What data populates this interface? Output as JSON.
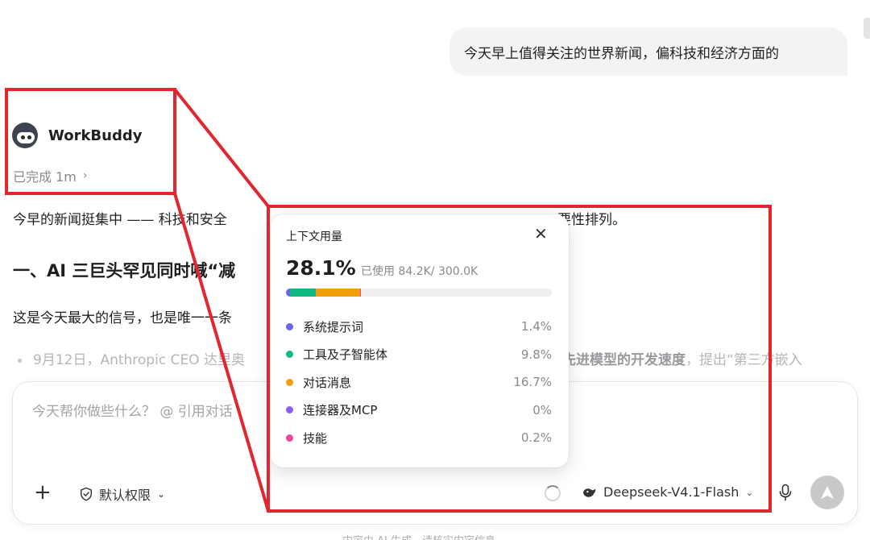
{
  "user_message": "今天早上值得关注的世界新闻，偏科技和经济方面的",
  "assistant": {
    "name": "WorkBuddy",
    "status": "已完成 1m"
  },
  "response": {
    "intro": "今早的新闻挺集中 —— 科技和安全",
    "intro_tail": "要性排列。",
    "heading": "一、AI 三巨头罕见同时喊“减",
    "paragraph": "这是今天最大的信号，也是唯一一条",
    "bullet": "9月12日，Anthropic CEO 达里奥",
    "bullet_tail_bold": "先进模型的开发速度",
    "bullet_tail": "，提出“第三方嵌入"
  },
  "composer": {
    "placeholder": "今天帮你做些什么？ @ 引用对话",
    "add_label": "+",
    "permission_label": "默认权限",
    "model_label": "Deepseek-V4.1-Flash"
  },
  "disclaimer": "内容由 AI 生成，请核实内容信息",
  "context_popover": {
    "title": "上下文用量",
    "percent": "28.1%",
    "used_text": "已使用 84.2K/ 300.0K",
    "items": [
      {
        "label": "系统提示词",
        "value": "1.4%",
        "fraction": 1.4,
        "color": "#6366f1"
      },
      {
        "label": "工具及子智能体",
        "value": "9.8%",
        "fraction": 9.8,
        "color": "#10b981"
      },
      {
        "label": "对话消息",
        "value": "16.7%",
        "fraction": 16.7,
        "color": "#f59e0b"
      },
      {
        "label": "连接器及MCP",
        "value": "0%",
        "fraction": 0,
        "color": "#8b5cf6"
      },
      {
        "label": "技能",
        "value": "0.2%",
        "fraction": 0.2,
        "color": "#ec4899"
      }
    ]
  },
  "colors": {
    "highlight": "#e3262e",
    "bubble": "#f3f3f4"
  }
}
